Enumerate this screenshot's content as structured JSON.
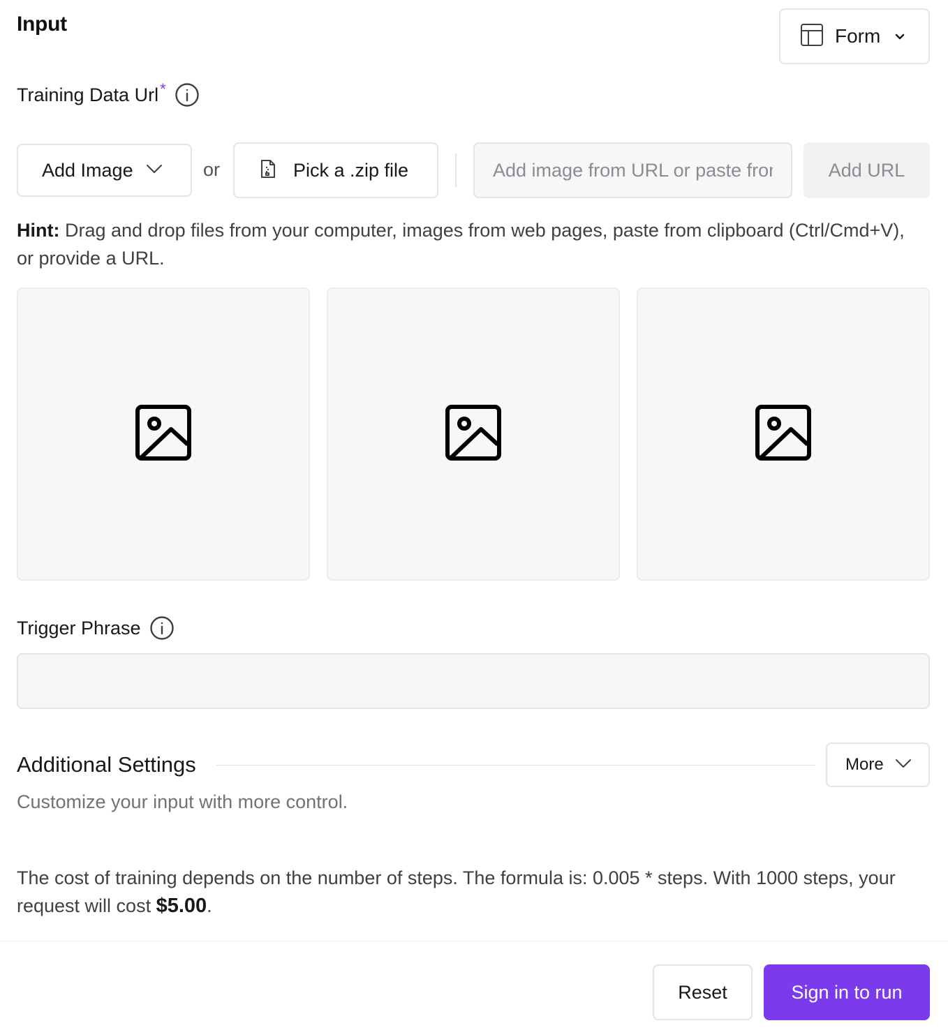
{
  "header": {
    "title": "Input",
    "view_mode": {
      "label": "Form",
      "icon": "layout-icon"
    }
  },
  "training_data": {
    "label": "Training Data Url",
    "required_mark": "*",
    "add_image_label": "Add Image",
    "or_text": "or",
    "zip_label": "Pick a .zip file",
    "url_placeholder": "Add image from URL or paste from clipboard",
    "add_url_label": "Add URL",
    "hint_label": "Hint:",
    "hint_text": " Drag and drop files from your computer, images from web pages, paste from clipboard (Ctrl/Cmd+V), or provide a URL.",
    "slots": [
      {
        "icon": "image-placeholder-icon"
      },
      {
        "icon": "image-placeholder-icon"
      },
      {
        "icon": "image-placeholder-icon"
      }
    ]
  },
  "trigger_phrase": {
    "label": "Trigger Phrase",
    "value": ""
  },
  "additional_settings": {
    "title": "Additional Settings",
    "more_label": "More",
    "description": "Customize your input with more control."
  },
  "cost": {
    "text": "The cost of training depends on the number of steps. The formula is: 0.005 * steps. With 1000 steps, your request will cost ",
    "amount": "$5.00",
    "suffix": "."
  },
  "footer": {
    "reset_label": "Reset",
    "run_label": "Sign in to run"
  },
  "colors": {
    "accent": "#7c3aed",
    "border": "#e4e4e7",
    "field_bg": "#f7f7f8"
  }
}
